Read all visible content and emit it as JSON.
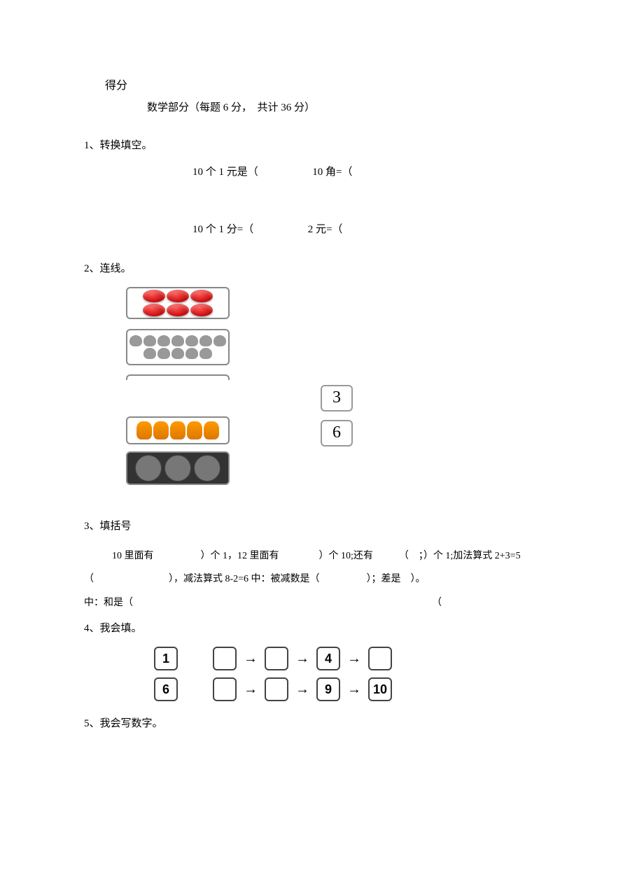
{
  "header": {
    "score_label": "得分",
    "section_title": "数学部分（每题 6 分，　共计 36 分）"
  },
  "q1": {
    "title": "1、转换填空。",
    "items": {
      "a": "10 个 1 元是（",
      "b": "10 角=（",
      "c": "10 个 1 分=（",
      "d": "2 元=（"
    }
  },
  "q2": {
    "title": "2、连线。",
    "numbers": {
      "a": "3",
      "b": "6"
    }
  },
  "q3": {
    "title": "3、填括号",
    "line1_a": "10 里面有",
    "line1_b": "）个 1，12 里面有",
    "line1_c": "）个 10;还有",
    "line1_d": "（　；）个 1;加法算式 2+3=5",
    "line2_a": "（",
    "line2_b": "），减法算式 8-2=6 中：被减数是（",
    "line2_c": "）；差是　）。",
    "line3_a": "中：和是（",
    "line3_b": "（"
  },
  "q4": {
    "title": "4、我会填。",
    "row1": {
      "a": "1",
      "b": "4"
    },
    "row2": {
      "a": "6",
      "b": "9",
      "c": "10"
    }
  },
  "q5": {
    "title": "5、我会写数字。"
  }
}
